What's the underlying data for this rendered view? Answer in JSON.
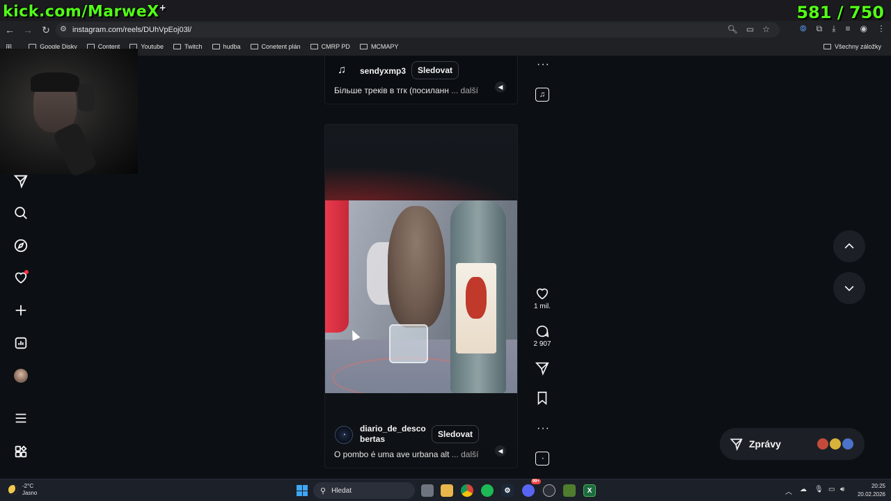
{
  "overlay": {
    "brand": "kick.com/MarweX",
    "brand_plus": "+",
    "counter": "581 / 750"
  },
  "browser": {
    "url": "instagram.com/reels/DUhVpEoj03l/",
    "bookmarks": [
      "Google Disky",
      "Content",
      "Youtube",
      "Twitch",
      "hudba",
      "Conetent plán",
      "CMRP PD",
      "MCMAPY"
    ],
    "all_bookmarks": "Všechny záložky"
  },
  "sidebar": {
    "items": [
      "messages-icon",
      "search-icon",
      "explore-icon",
      "notifications-icon",
      "create-icon",
      "dashboard-icon",
      "profile-avatar",
      "menu-icon",
      "more-apps-icon"
    ]
  },
  "reel_top": {
    "username": "sendyxmp3",
    "follow": "Sledovat",
    "caption": "Більше треків в тгк (посиланн",
    "more": "... další"
  },
  "reel_main": {
    "username_line1": "diario_de_desco",
    "username_line2": "bertas",
    "follow": "Sledovat",
    "caption": "O pombo é uma ave urbana alt",
    "more": "... další",
    "likes": "1 mil.",
    "comments": "2 907"
  },
  "messages": {
    "label": "Zprávy"
  },
  "taskbar": {
    "temperature": "-2°C",
    "condition": "Jasno",
    "search": "Hledat",
    "time": "20:25",
    "date": "20.02.2026",
    "discord_badge": "99+"
  }
}
